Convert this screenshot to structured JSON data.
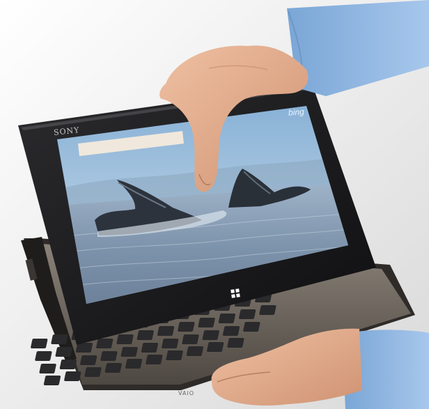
{
  "device": {
    "brand_label": "SONY",
    "search_app_label": "bing",
    "keyboard_logo": "VAIO",
    "colors": {
      "background": "#ffffff",
      "bezel": "#1a1a1c",
      "keyboard_deck": "#6a6258",
      "keys": "#2a2a2c",
      "sky": "#8cb4d8",
      "ocean": "#8aa0b8",
      "whale": "#2f3640",
      "skin": "#e2ab8c",
      "shirt": "#8ab4e2",
      "search_box": "#f0e8dc"
    }
  },
  "icons": [
    "windows-icon"
  ]
}
